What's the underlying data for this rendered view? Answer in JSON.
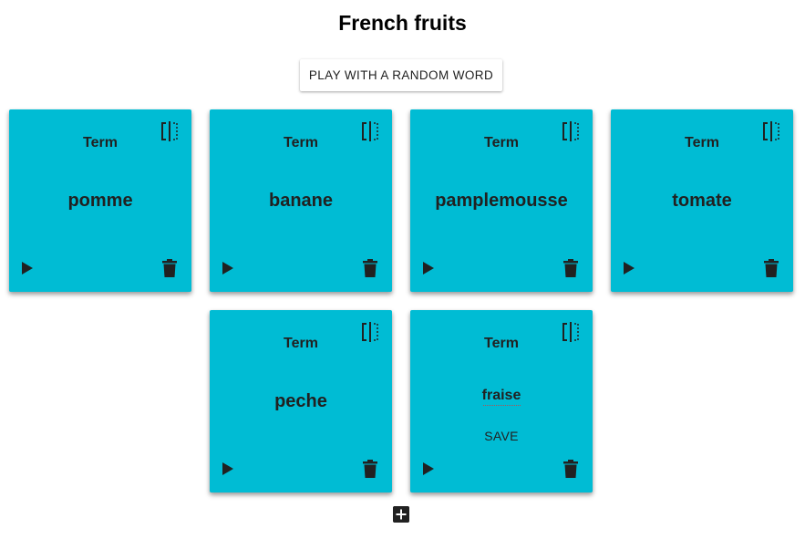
{
  "page": {
    "title": "French fruits"
  },
  "toolbar": {
    "random_label": "PLAY WITH A RANDOM WORD"
  },
  "cards": [
    {
      "term_label": "Term",
      "word": "pomme"
    },
    {
      "term_label": "Term",
      "word": "banane"
    },
    {
      "term_label": "Term",
      "word": "pamplemousse"
    },
    {
      "term_label": "Term",
      "word": "tomate"
    },
    {
      "term_label": "Term",
      "word": "peche"
    },
    {
      "term_label": "Term",
      "word_input_value": "fraise",
      "save_label": "SAVE"
    }
  ],
  "colors": {
    "card": "#00bcd4",
    "text": "#212121"
  },
  "icons": {
    "flip": "flip-icon",
    "play": "play-icon",
    "delete": "trash-icon",
    "add": "add-icon"
  }
}
